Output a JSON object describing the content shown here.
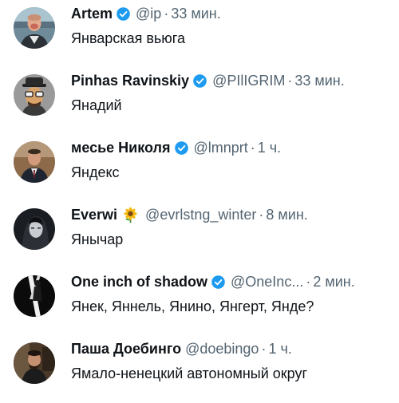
{
  "colors": {
    "text_primary": "#0f1419",
    "text_secondary": "#536471",
    "verified_blue": "#1d9bf0",
    "background": "#ffffff"
  },
  "replies": [
    {
      "name": "Artem",
      "verified": true,
      "handle": "@ip",
      "separator": "·",
      "time": "33 мин.",
      "text": "Январская вьюга",
      "avatar_icon": "person-photo-avatar"
    },
    {
      "name": "Pinhas Ravinskiy",
      "verified": true,
      "handle": "@PIlIGRIM",
      "separator": "·",
      "time": "33 мин.",
      "text": "Янадий",
      "avatar_icon": "cartoon-man-hat-avatar"
    },
    {
      "name": "месье Николя",
      "verified": true,
      "handle": "@lmnprt",
      "separator": "·",
      "time": "1 ч.",
      "text": "Яндекс",
      "avatar_icon": "man-suit-avatar"
    },
    {
      "name": "Everwi",
      "verified": false,
      "badge_emoji": "sunflower-icon",
      "handle": "@evrlstng_winter",
      "separator": "·",
      "time": "8 мин.",
      "text": "Янычар",
      "avatar_icon": "dark-portrait-avatar"
    },
    {
      "name": "One inch of shadow",
      "verified": true,
      "handle": "@OneInc...",
      "separator": "·",
      "time": "2 мин.",
      "text": "Янек, Яннель, Янино, Янгерт, Янде?",
      "avatar_icon": "shadow-figure-avatar"
    },
    {
      "name": "Паша Доебинго",
      "verified": false,
      "handle": "@doebingo",
      "separator": "·",
      "time": "1 ч.",
      "text": "Ямало-ненецкий автономный округ",
      "avatar_icon": "man-sitting-avatar"
    }
  ]
}
